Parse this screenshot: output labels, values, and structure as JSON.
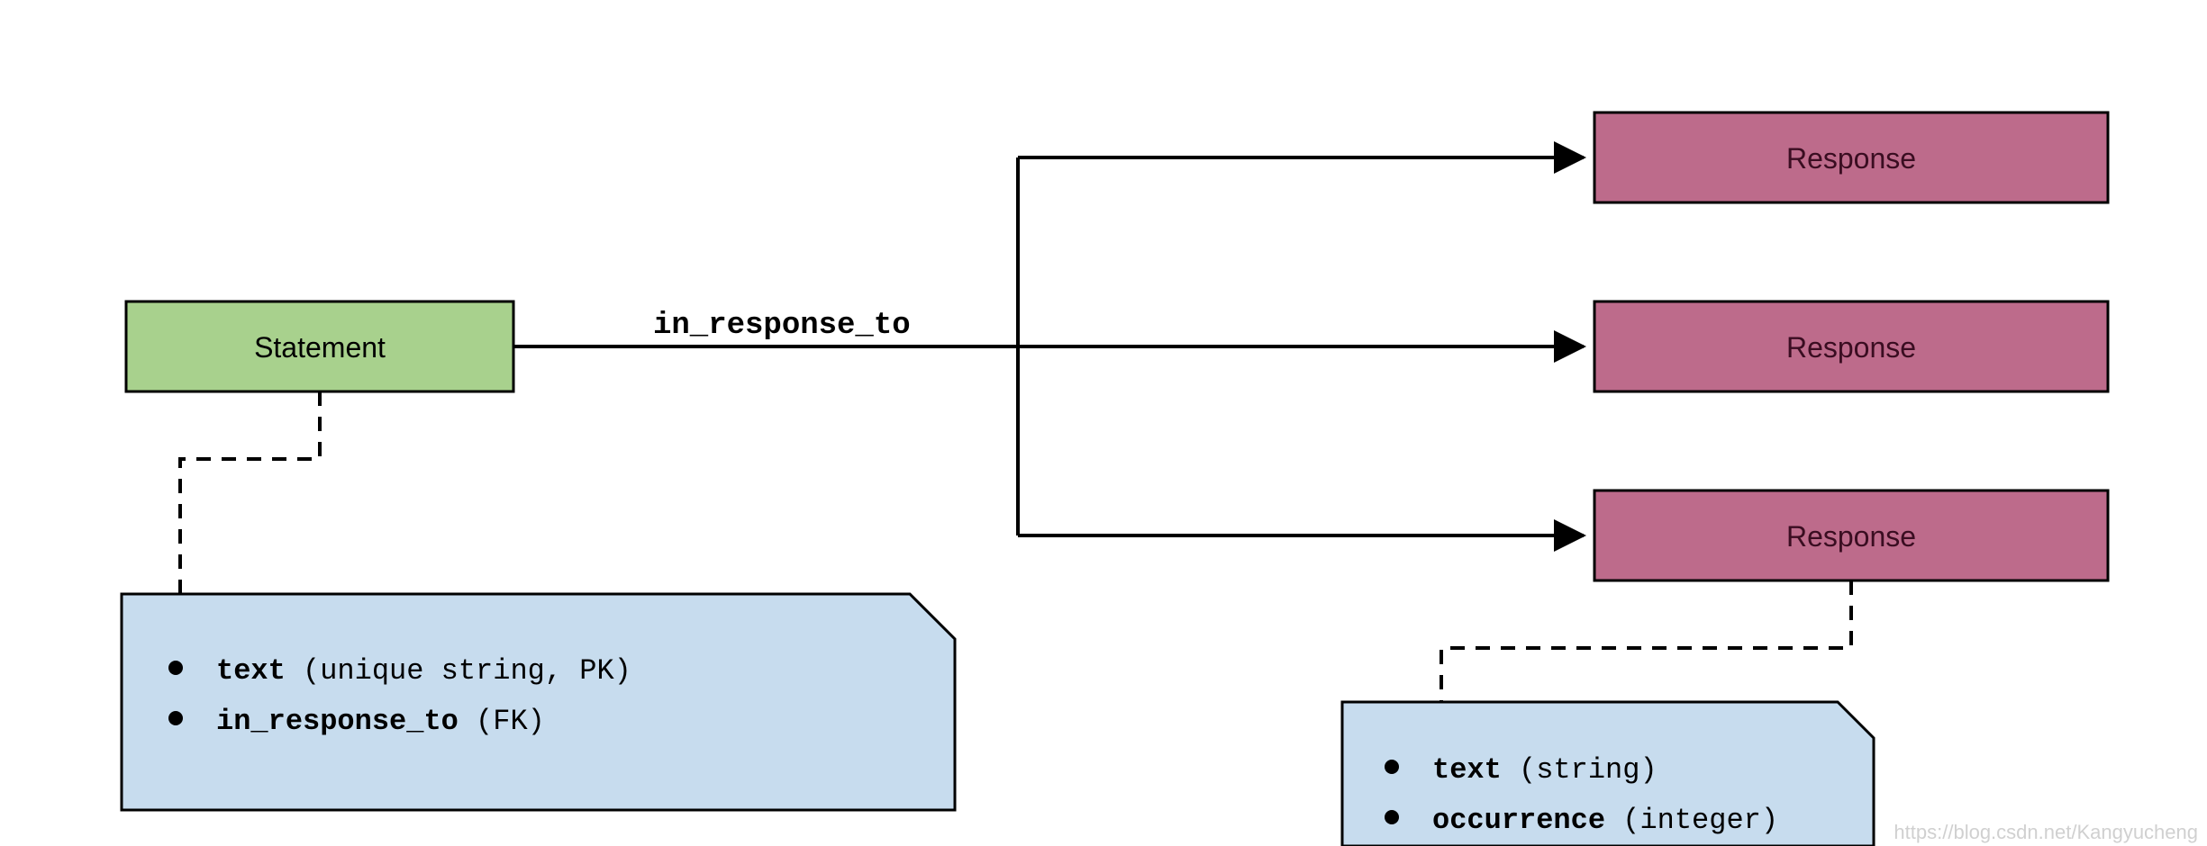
{
  "statement": {
    "label": "Statement",
    "note": {
      "bullets": [
        {
          "key": "text",
          "detail": "(unique string, PK)"
        },
        {
          "key": "in_response_to",
          "detail": "(FK)"
        }
      ]
    }
  },
  "edge": {
    "label": "in_response_to"
  },
  "responses": {
    "label_1": "Response",
    "label_2": "Response",
    "label_3": "Response",
    "note": {
      "bullets": [
        {
          "key": "text",
          "detail": "(string)"
        },
        {
          "key": "occurrence",
          "detail": "(integer)"
        }
      ]
    }
  },
  "colors": {
    "statement_fill": "#a8d18d",
    "response_fill": "#bd6b8b",
    "note_fill": "#c7dcee",
    "stroke": "#000000"
  },
  "watermark": "https://blog.csdn.net/Kangyucheng"
}
